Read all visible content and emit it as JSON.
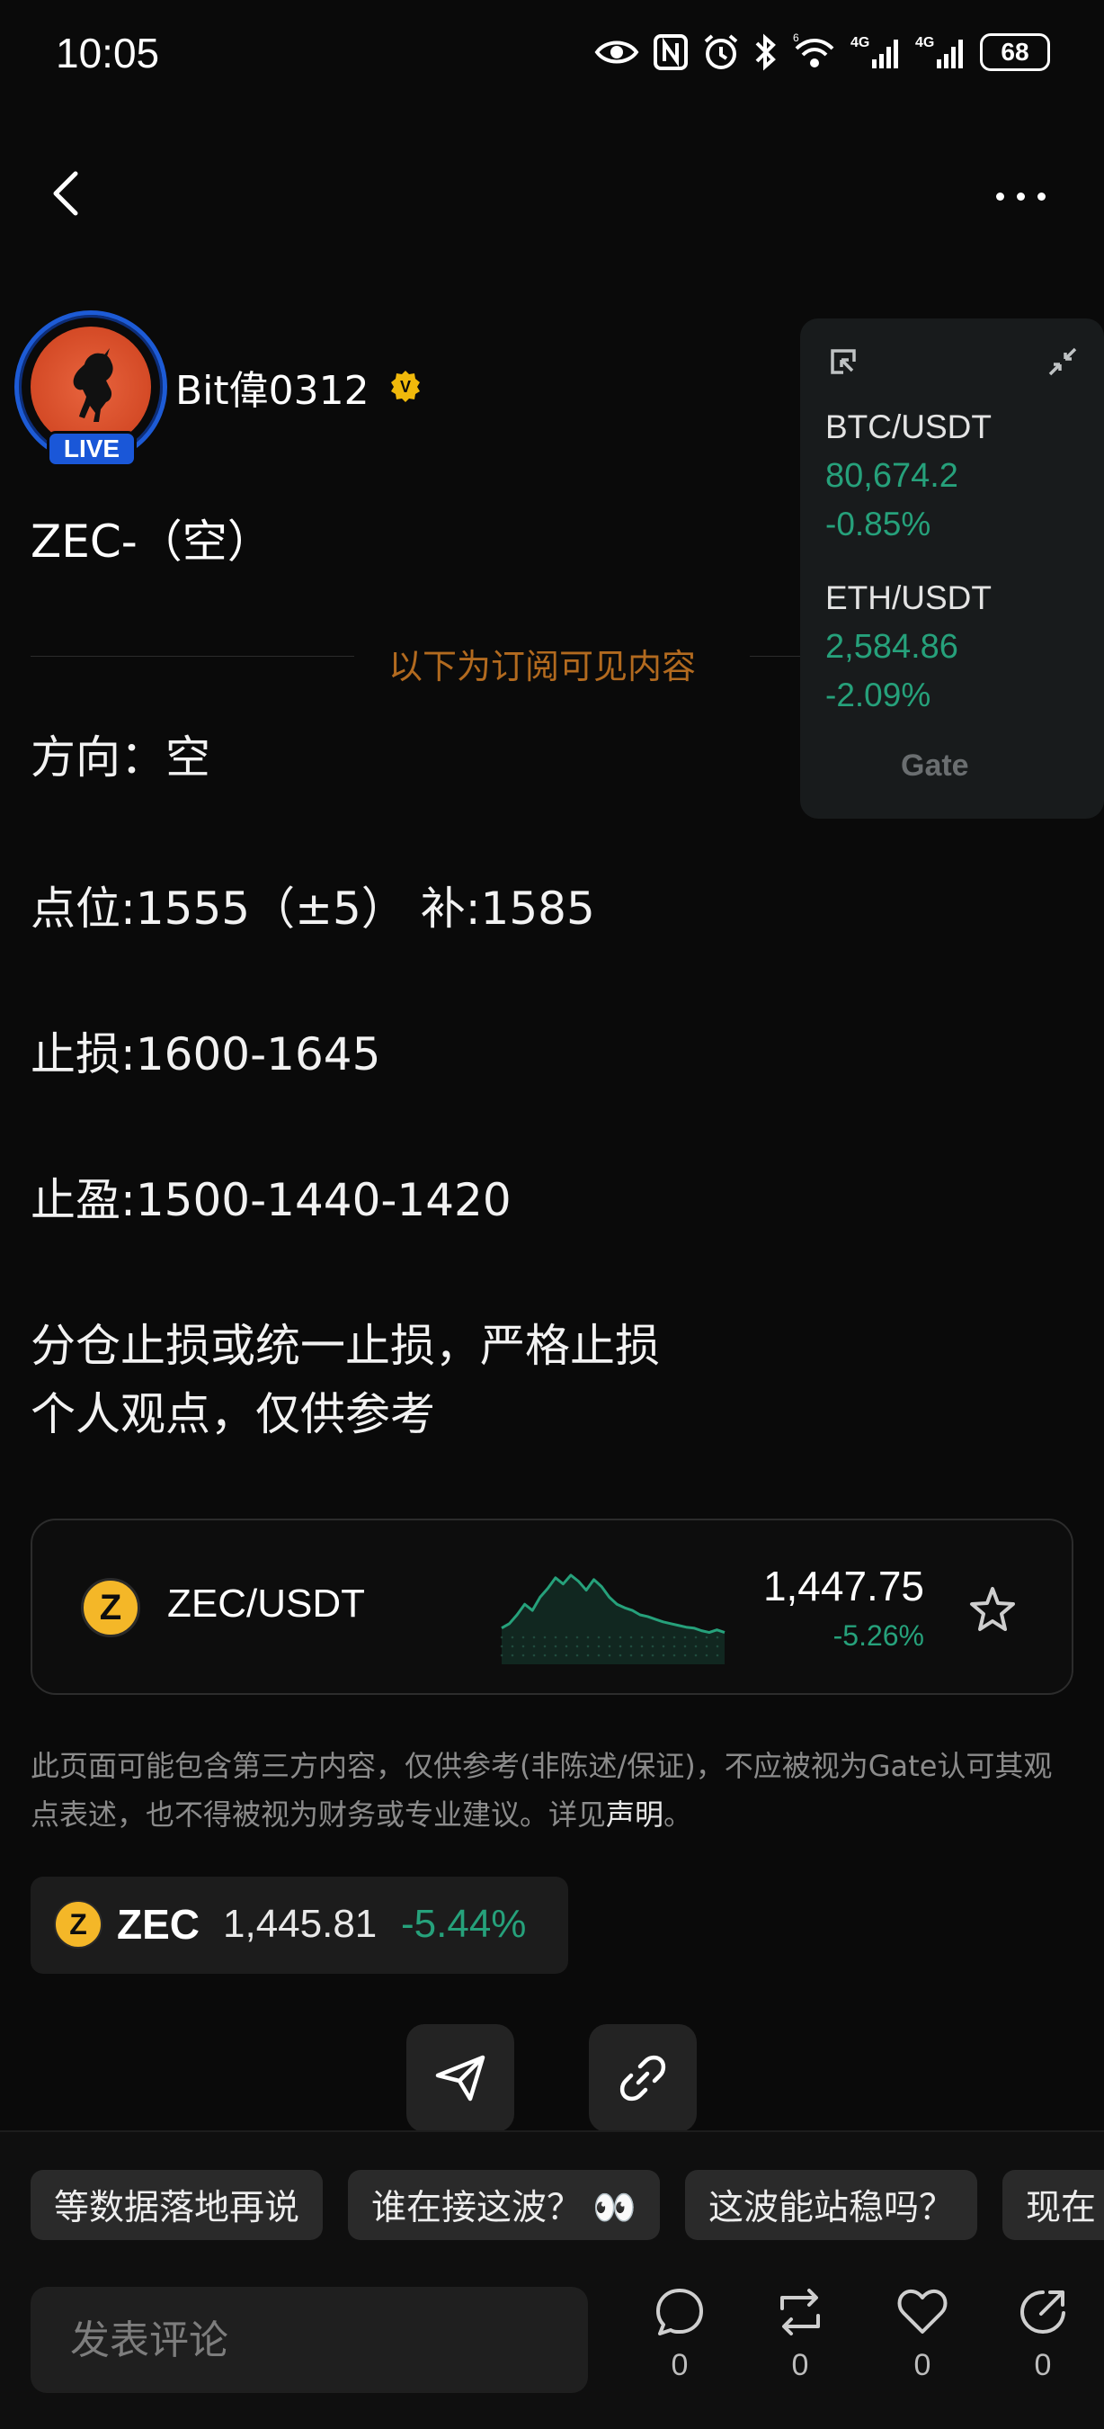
{
  "status_bar": {
    "time": "10:05",
    "battery": "68",
    "icons": [
      "eye-icon",
      "nfc-icon",
      "alarm-icon",
      "bluetooth-icon",
      "wifi-icon",
      "signal-4g-icon",
      "signal-4g-icon"
    ]
  },
  "nav": {
    "back_icon": "chevron-left-icon",
    "more_icon": "more-horizontal-icon"
  },
  "author": {
    "name": "Bit偉0312",
    "live_label": "LIVE",
    "verified_badge": "V"
  },
  "post": {
    "title": "ZEC-（空）",
    "subscriber_divider": "以下为订阅可见内容",
    "lines": [
      "方向：空",
      "点位:1555（±5） 补:1585",
      "止损:1600-1645",
      "止盈:1500-1440-1420",
      " 分仓止损或统一止损，严格止损",
      "个人观点，仅供参考"
    ]
  },
  "float_widget": {
    "tickers": [
      {
        "pair": "BTC/USDT",
        "price": "80,674.2",
        "change": "-0.85%"
      },
      {
        "pair": "ETH/USDT",
        "price": "2,584.86",
        "change": "-2.09%"
      }
    ],
    "brand": "Gate",
    "up_color": "#26a17b"
  },
  "ticker_card": {
    "coin_letter": "Z",
    "pair": "ZEC/USDT",
    "price": "1,447.75",
    "change": "-5.26%",
    "star_icon": "star-outline-icon",
    "sparkline": [
      0.35,
      0.4,
      0.5,
      0.62,
      0.55,
      0.7,
      0.8,
      0.92,
      0.85,
      0.95,
      0.88,
      0.78,
      0.9,
      0.82,
      0.7,
      0.62,
      0.58,
      0.55,
      0.5,
      0.48,
      0.45,
      0.42,
      0.4,
      0.38,
      0.36,
      0.35,
      0.32,
      0.3,
      0.33,
      0.3
    ]
  },
  "disclaimer": {
    "text": "此页面可能包含第三方内容，仅供参考(非陈述/保证)，不应被视为Gate认可其观点表述，也不得被视为财务或专业建议。详见",
    "link": "声明",
    "end": "。"
  },
  "coin_pill": {
    "coin_letter": "Z",
    "symbol": "ZEC",
    "price": "1,445.81",
    "change": "-5.44%"
  },
  "share": {
    "send_icon": "send-icon",
    "link_icon": "link-icon"
  },
  "bottom": {
    "chips": [
      "等数据落地再说",
      "谁在接这波？ 👀",
      "这波能站稳吗？",
      "现在"
    ],
    "comment_placeholder": "发表评论",
    "actions": [
      {
        "icon": "comment-icon",
        "count": "0"
      },
      {
        "icon": "repost-icon",
        "count": "0"
      },
      {
        "icon": "heart-icon",
        "count": "0"
      },
      {
        "icon": "share-icon",
        "count": "0"
      }
    ]
  }
}
